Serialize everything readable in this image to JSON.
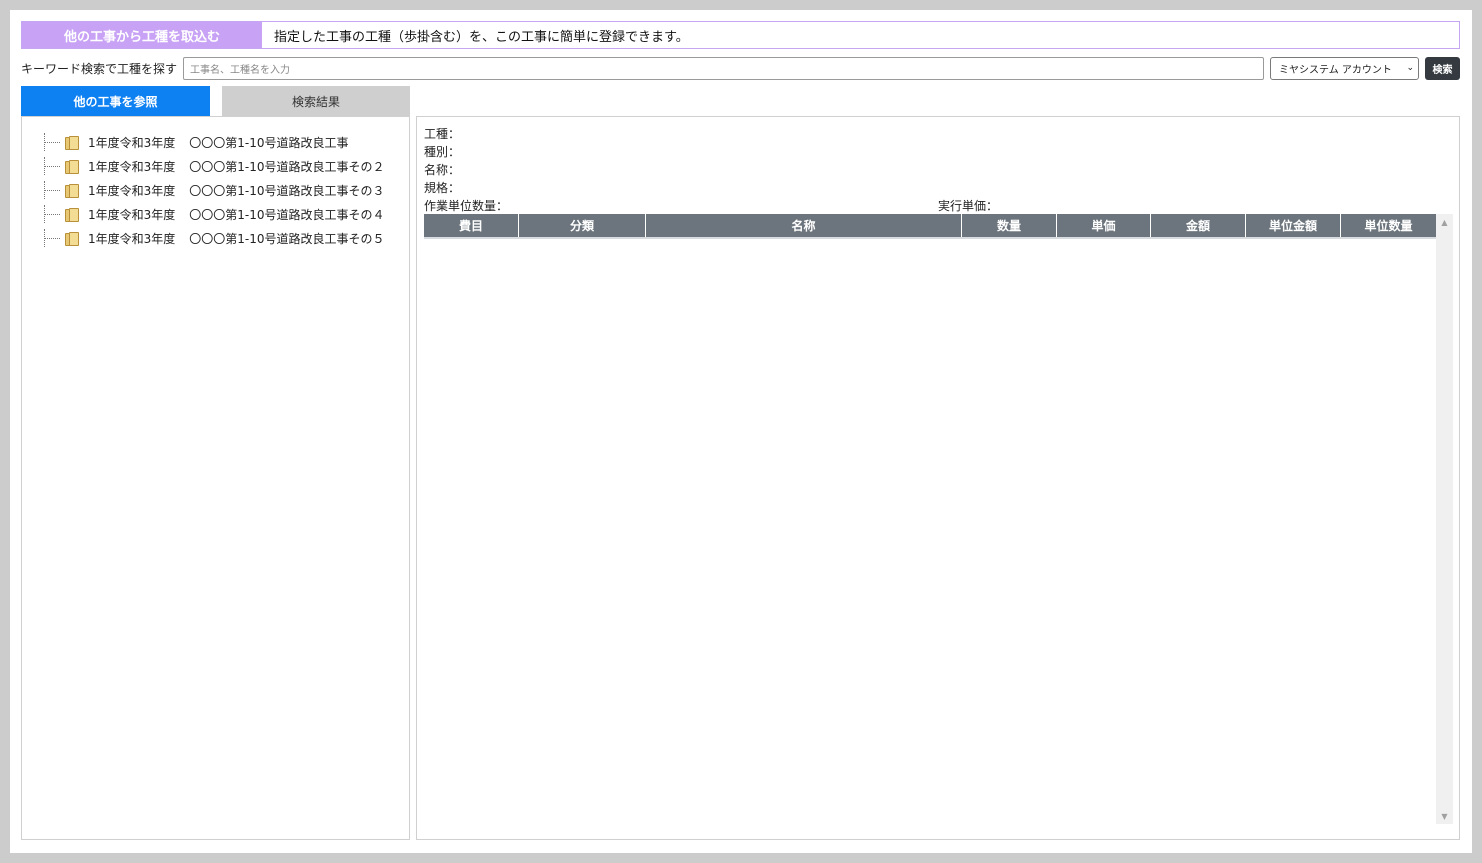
{
  "banner": {
    "label": "他の工事から工種を取込む",
    "description": "指定した工事の工種（歩掛含む）を、この工事に簡単に登録できます。"
  },
  "search": {
    "label": "キーワード検索で工種を探す",
    "placeholder": "工事名、工種名を入力",
    "account": "ミヤシステム アカウント",
    "button": "検索"
  },
  "tabs": {
    "reference": "他の工事を参照",
    "results": "検索結果"
  },
  "tree": [
    {
      "year": "1年度令和3年度",
      "name": "〇〇〇第1-10号道路改良工事"
    },
    {
      "year": "1年度令和3年度",
      "name": "〇〇〇第1-10号道路改良工事その２"
    },
    {
      "year": "1年度令和3年度",
      "name": "〇〇〇第1-10号道路改良工事その３"
    },
    {
      "year": "1年度令和3年度",
      "name": "〇〇〇第1-10号道路改良工事その４"
    },
    {
      "year": "1年度令和3年度",
      "name": "〇〇〇第1-10号道路改良工事その５"
    }
  ],
  "detail": {
    "work_type": "工種：",
    "category": "種別：",
    "name": "名称：",
    "spec": "規格：",
    "unit_quantity": "作業単位数量：",
    "exec_unit_price": "実行単価："
  },
  "grid": {
    "columns": [
      "費目",
      "分類",
      "名称",
      "数量",
      "単価",
      "金額",
      "単位金額",
      "単位数量"
    ]
  },
  "colors": {
    "banner_accent": "#c8a3f5",
    "active_tab": "#0d80f2",
    "grid_header": "#6c757d",
    "search_button": "#343a40"
  }
}
